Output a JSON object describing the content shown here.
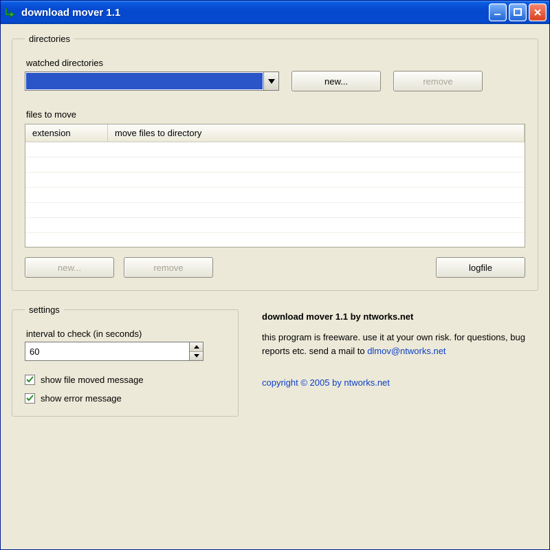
{
  "window": {
    "title": "download mover 1.1"
  },
  "directories": {
    "legend": "directories",
    "watched_label": "watched directories",
    "new_label": "new...",
    "remove_label": "remove",
    "files_label": "files to move",
    "columns": {
      "extension": "extension",
      "move_to": "move files to directory"
    },
    "files_new_label": "new...",
    "files_remove_label": "remove",
    "logfile_label": "logfile"
  },
  "settings": {
    "legend": "settings",
    "interval_label": "interval to check (in seconds)",
    "interval_value": "60",
    "show_moved_label": "show file moved message",
    "show_moved_checked": true,
    "show_error_label": "show error message",
    "show_error_checked": true
  },
  "about": {
    "heading": "download mover 1.1 by ntworks.net",
    "body_before": "this program is freeware. use it at your own risk. for questions, bug reports etc. send a mail to ",
    "email": "dlmov@ntworks.net",
    "copyright": "copyright © 2005 by ntworks.net"
  }
}
